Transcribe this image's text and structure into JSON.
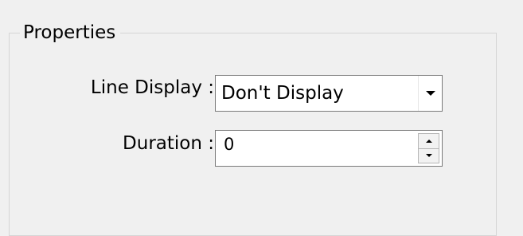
{
  "group": {
    "title": "Properties"
  },
  "line_display": {
    "label": "Line Display :",
    "selected_value": "Don't Display"
  },
  "duration": {
    "label": "Duration :",
    "value": "0"
  },
  "icons": {
    "dropdown": "chevron-down-icon",
    "spin_up": "arrow-up-icon",
    "spin_down": "arrow-down-icon"
  },
  "colors": {
    "background": "#f0f0f0",
    "border": "#7a7a7a",
    "group_border": "#d6d6d6"
  }
}
